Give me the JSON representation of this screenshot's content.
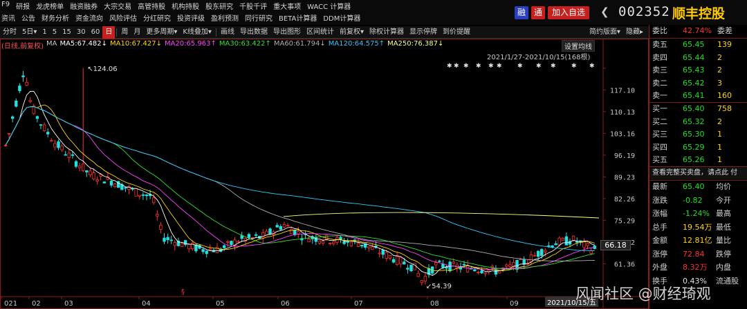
{
  "menu_row1": [
    "F9",
    "研报",
    "龙虎榜单",
    "融资融券",
    "大宗交易",
    "高管持股",
    "机构持股",
    "股东研究",
    "千股千评",
    "重大事项",
    "WACC 计算器"
  ],
  "menu_row2": [
    "资讯",
    "公告",
    "财务分析",
    "资金流向",
    "风险评估",
    "分红研究",
    "投资评级",
    "盈利预测",
    "同行研究",
    "BETA计算器",
    "DDM计算器"
  ],
  "header": {
    "rong": "融",
    "tong": "通",
    "add": "加入自选",
    "arrow": "❮",
    "code": "002352",
    "name": "顺丰控股"
  },
  "toolbar": [
    "分时",
    "5日▾",
    "1",
    "5",
    "15",
    "30",
    "60",
    "日",
    "周",
    "月",
    "更多周期▾",
    "K线叠加▾",
    "画线",
    "导出数据",
    "导出图形",
    "区间统计",
    "前复权▾",
    "除权计算器",
    "显示停牌",
    "到价提醒"
  ],
  "toolbar_active": "日",
  "toolbar_right": [
    "简约版面▾",
    "隐藏▸"
  ],
  "ma": {
    "label": "(日线,前复权)",
    "ma": "MA",
    "items": [
      {
        "t": "MA5:67.482↓",
        "color": "#ffffff"
      },
      {
        "t": "MA10:67.427↓",
        "color": "#ffd700"
      },
      {
        "t": "MA20:65.963↑",
        "color": "#ff40ff"
      },
      {
        "t": "MA30:63.422↑",
        "color": "#30e030"
      },
      {
        "t": "MA60:61.794↓",
        "color": "#b0b0b0"
      },
      {
        "t": "MA120:64.575↑",
        "color": "#30c8ff"
      },
      {
        "t": "MA250:76.387↓",
        "color": "#ffff80"
      }
    ]
  },
  "range": "2021/1/27-2021/10/15(168根)",
  "set_ma": "设置均线",
  "y_ticks": [
    "124.06",
    "117.10",
    "110.13",
    "103.16",
    "96.19",
    "89.23",
    "82.26",
    "75.29",
    "68.32",
    "61.36"
  ],
  "x_ticks": [
    "021",
    "02",
    "03",
    "04",
    "05",
    "06",
    "07",
    "08",
    "09"
  ],
  "high_label": "124.06",
  "low_label": "54.39",
  "current_price": "66.18",
  "date_box": "2021/10/15/五",
  "marker": "§",
  "right": {
    "weibi_label": "委比",
    "weibi": "42.74%",
    "weicha_label": "委差",
    "asks": [
      {
        "n": "卖五",
        "p": "65.45",
        "v": "139"
      },
      {
        "n": "卖四",
        "p": "65.44",
        "v": "2"
      },
      {
        "n": "卖三",
        "p": "65.43",
        "v": "2"
      },
      {
        "n": "卖二",
        "p": "65.42",
        "v": "3"
      },
      {
        "n": "卖一",
        "p": "65.41",
        "v": "160"
      }
    ],
    "bids": [
      {
        "n": "买一",
        "p": "65.40",
        "v": "758"
      },
      {
        "n": "买二",
        "p": "65.32",
        "v": "2"
      },
      {
        "n": "买三",
        "p": "65.30",
        "v": "1"
      },
      {
        "n": "买四",
        "p": "65.29",
        "v": "1"
      },
      {
        "n": "买五",
        "p": "65.26",
        "v": "1"
      }
    ],
    "link": "查看完整买卖盘，请点此 付",
    "stats": [
      {
        "a": "最新",
        "b": "65.40",
        "bc": "green",
        "c": "均价"
      },
      {
        "a": "涨跌",
        "b": "-0.82",
        "bc": "green",
        "c": "今开"
      },
      {
        "a": "涨幅",
        "b": "-1.24%",
        "bc": "green",
        "c": "最高"
      },
      {
        "a": "总手",
        "b": "19.54万",
        "bc": "yellow",
        "c": "最低"
      },
      {
        "a": "金额",
        "b": "12.81亿",
        "bc": "yellow",
        "c": "量比"
      },
      {
        "a": "涨停",
        "b": "72.84",
        "bc": "red",
        "c": "跌停"
      },
      {
        "a": "外盘",
        "b": "8.32万",
        "bc": "red",
        "c": "内盘"
      },
      {
        "a": "换手",
        "b": "0.43%",
        "bc": "white",
        "c": "流通股"
      }
    ]
  },
  "watermark": "风闻社区 @财经琦观",
  "colors": {
    "up": "#ff3030",
    "down": "#20e0e0",
    "ma5": "#ffffff",
    "ma10": "#ffd700",
    "ma20": "#ff40ff",
    "ma30": "#30e030",
    "ma60": "#b0b0b0",
    "ma120": "#30c8ff",
    "ma250": "#ffff80"
  }
}
